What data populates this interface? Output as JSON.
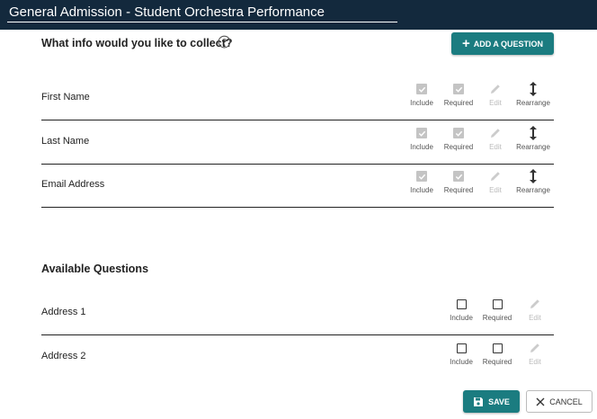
{
  "header": {
    "title": "General Admission - Student Orchestra Performance"
  },
  "collect": {
    "heading": "What info would you like to collect?",
    "add_button_label": "ADD A QUESTION",
    "captions": {
      "include": "Include",
      "required": "Required",
      "edit": "Edit",
      "rearrange": "Rearrange"
    },
    "rows": [
      {
        "label": "First Name",
        "include": true,
        "required": true
      },
      {
        "label": "Last Name",
        "include": true,
        "required": true
      },
      {
        "label": "Email Address",
        "include": true,
        "required": true
      }
    ]
  },
  "available": {
    "heading": "Available Questions",
    "captions": {
      "include": "Include",
      "required": "Required",
      "edit": "Edit"
    },
    "rows": [
      {
        "label": "Address 1",
        "include": false,
        "required": false
      },
      {
        "label": "Address 2",
        "include": false,
        "required": false
      }
    ]
  },
  "footer": {
    "save_label": "SAVE",
    "cancel_label": "CANCEL"
  },
  "colors": {
    "header_bg": "#13293d",
    "accent": "#1b7c80",
    "checked_gray": "#c4c4c4"
  }
}
